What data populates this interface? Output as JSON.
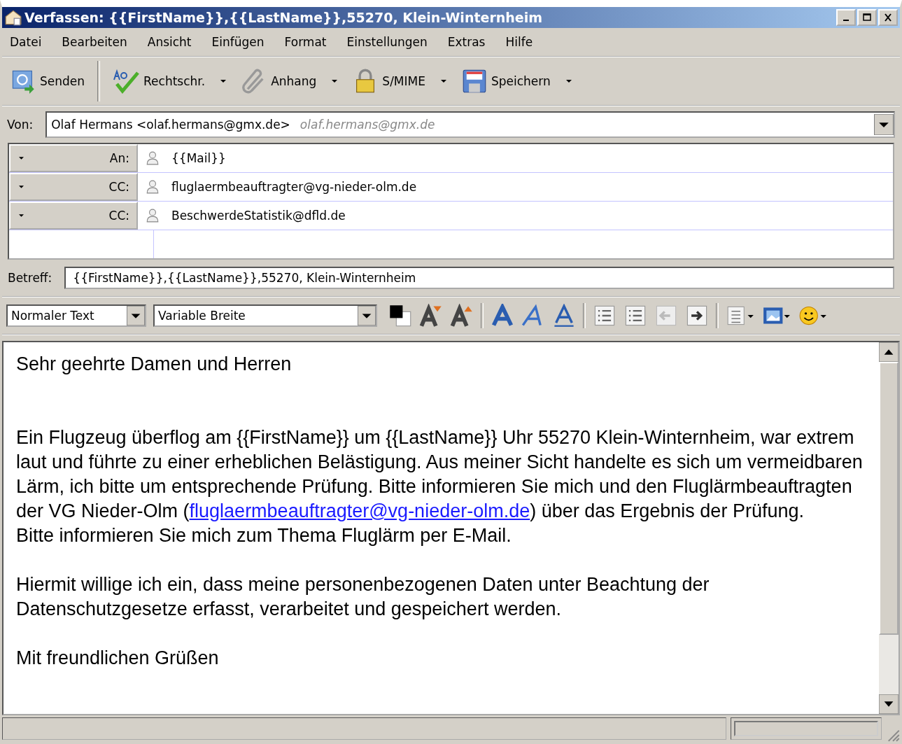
{
  "window": {
    "title": "Verfassen: {{FirstName}},{{LastName}},55270, Klein-Winternheim"
  },
  "menu": [
    "Datei",
    "Bearbeiten",
    "Ansicht",
    "Einfügen",
    "Format",
    "Einstellungen",
    "Extras",
    "Hilfe"
  ],
  "toolbar": [
    {
      "kind": "send",
      "label": "Senden",
      "dropdown": false
    },
    {
      "kind": "spell",
      "label": "Rechtschr.",
      "dropdown": true
    },
    {
      "kind": "attach",
      "label": "Anhang",
      "dropdown": true
    },
    {
      "kind": "lock",
      "label": "S/MIME",
      "dropdown": true
    },
    {
      "kind": "save",
      "label": "Speichern",
      "dropdown": true
    }
  ],
  "from": {
    "label": "Von:",
    "value": "Olaf Hermans <olaf.hermans@gmx.de>",
    "hint": "olaf.hermans@gmx.de"
  },
  "recipients": [
    {
      "type": "An:",
      "address": "{{Mail}}"
    },
    {
      "type": "CC:",
      "address": "fluglaermbeauftragter@vg-nieder-olm.de"
    },
    {
      "type": "CC:",
      "address": "BeschwerdeStatistik@dfld.de"
    }
  ],
  "subject": {
    "label": "Betreff:",
    "value": "{{FirstName}},{{LastName}},55270, Klein-Winternheim"
  },
  "format_bar": {
    "paragraph_style": "Normaler Text",
    "font": "Variable Breite"
  },
  "body": [
    {
      "text": "Sehr geehrte Damen und Herren"
    },
    {
      "kind": "blank"
    },
    {
      "kind": "blank"
    },
    {
      "text": "Ein Flugzeug überflog am {{FirstName}} um {{LastName}} Uhr 55270 Klein-Winternheim, war extrem laut und führte zu einer erheblichen Belästigung. Aus meiner Sicht handelte es sich um vermeidbaren Lärm, ich bitte um entsprechende Prüfung. Bitte informieren Sie mich und den Fluglärmbeauftragten der VG Nieder-Olm (",
      "link": "fluglaermbeauftragter@vg-nieder-olm.de",
      "after": ") über das Ergebnis der Prüfung."
    },
    {
      "text": "Bitte informieren Sie mich zum Thema Fluglärm per E-Mail."
    },
    {
      "kind": "blank"
    },
    {
      "text": "Hiermit willige ich ein, dass meine personenbezogenen Daten unter Beachtung der Datenschutzgesetze erfasst, verarbeitet und gespeichert werden."
    },
    {
      "kind": "blank"
    },
    {
      "text": "Mit freundlichen Grüßen"
    }
  ]
}
